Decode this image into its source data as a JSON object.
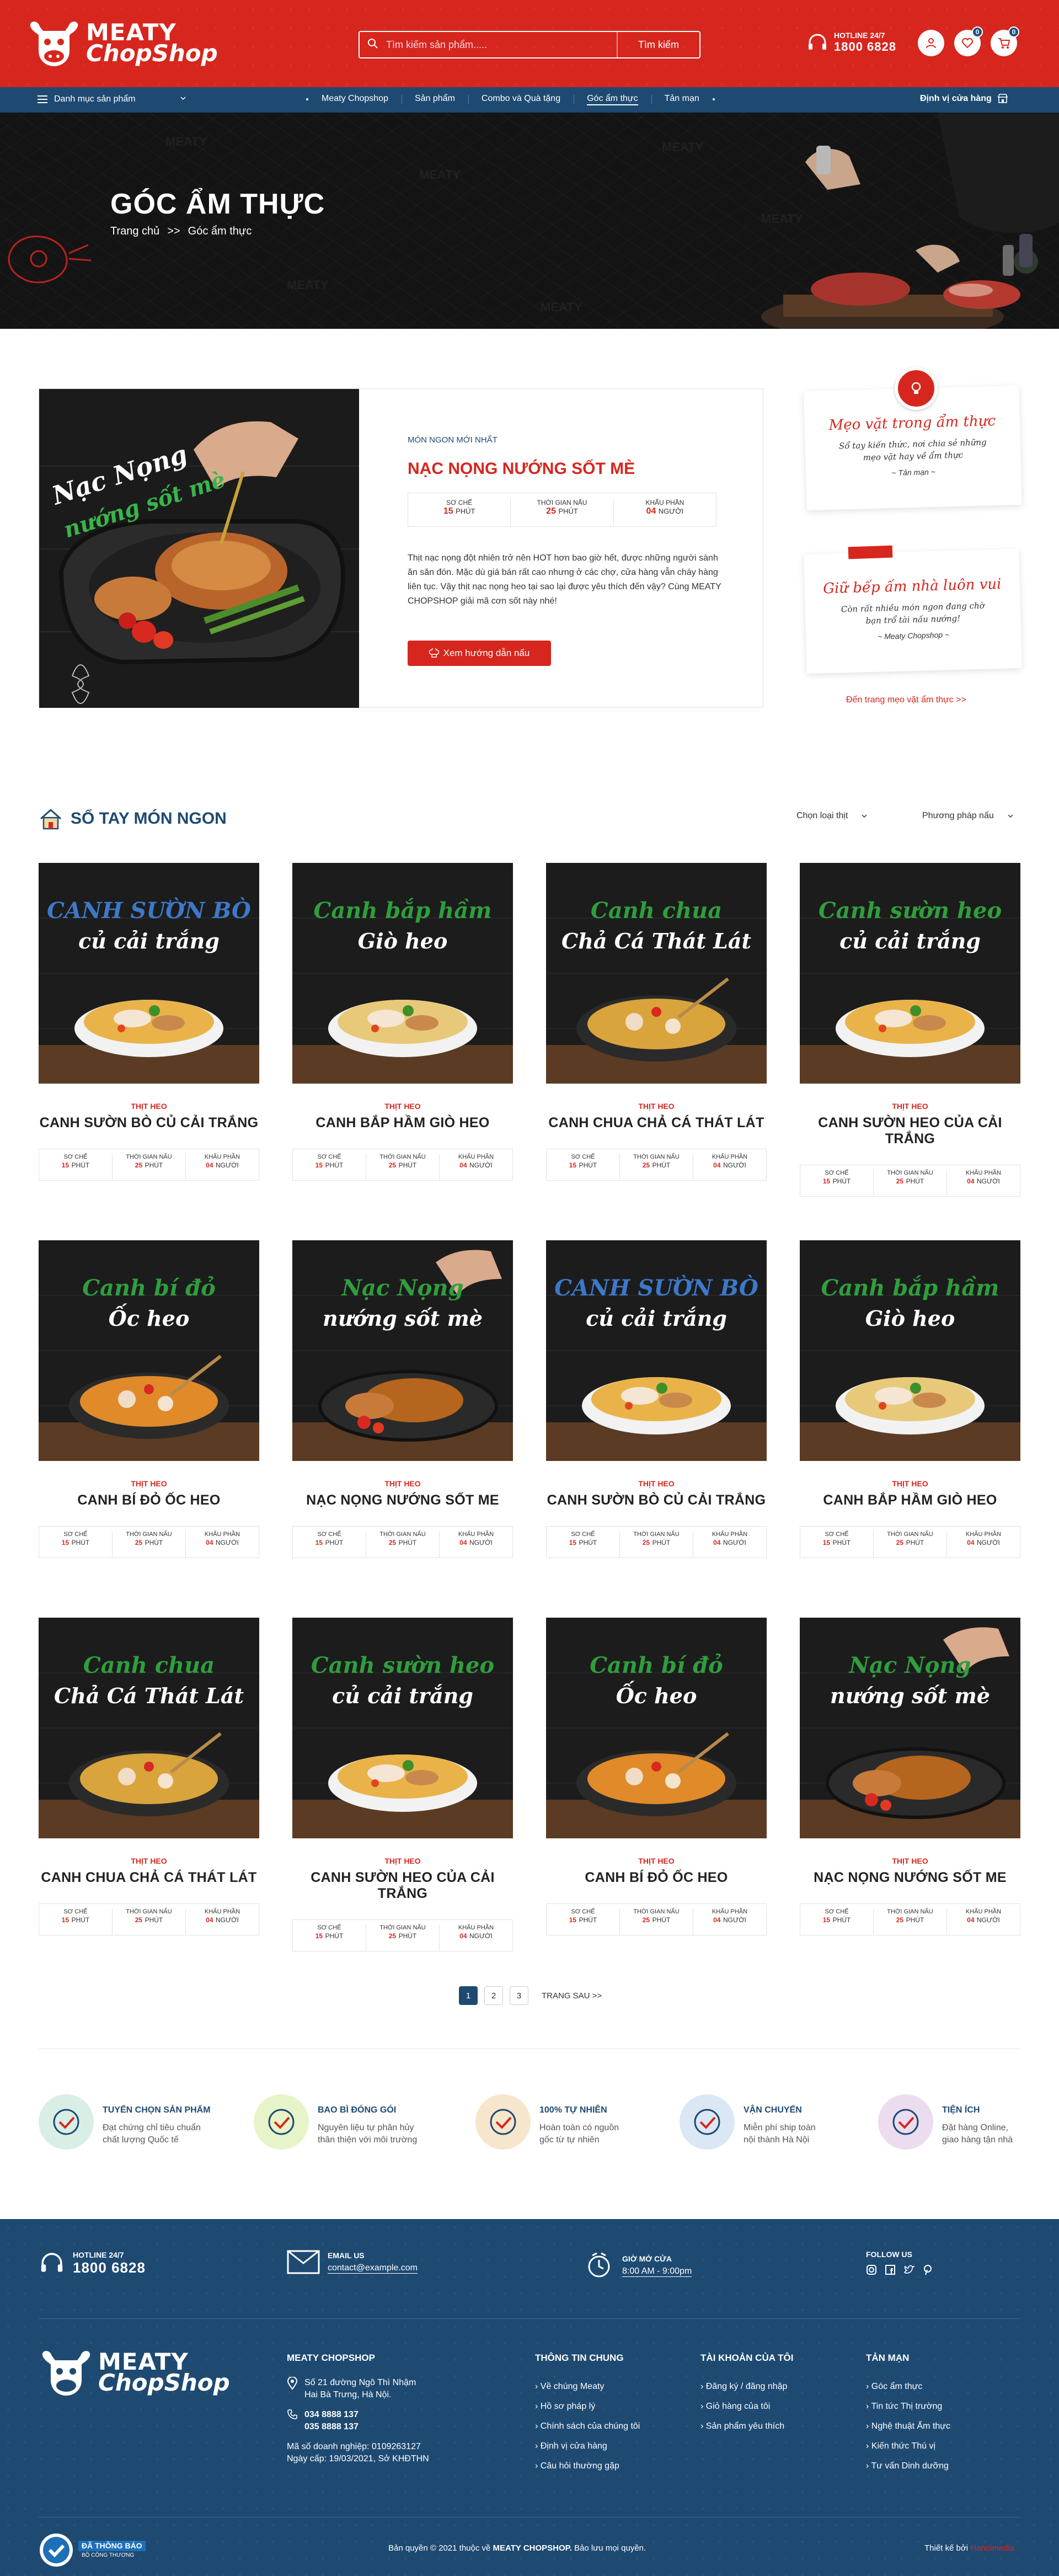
{
  "header": {
    "logo_line1": "MEATY",
    "logo_line2": "ChopShop",
    "search_placeholder": "Tìm kiếm sản phẩm.....",
    "search_button": "Tìm kiếm",
    "hotline_label": "HOTLINE 24/7",
    "hotline_number": "1800 6828",
    "wishlist_count": "0",
    "cart_count": "0"
  },
  "nav": {
    "category_label": "Danh mục sản phẩm",
    "items": [
      "Meaty Chopshop",
      "Sản phẩm",
      "Combo và Quà tặng",
      "Góc ẩm thực",
      "Tản mạn"
    ],
    "store_label": "Định vị cửa hàng"
  },
  "hero": {
    "title": "GÓC ẨM THỰC",
    "breadcrumb_home": "Trang chủ",
    "breadcrumb_sep": ">>",
    "breadcrumb_current": "Góc ẩm thực"
  },
  "featured": {
    "tag": "MÓN NGON MỚI NHẤT",
    "title": "NẠC NỌNG NƯỚNG SỐT MÈ",
    "image_text_1": "Nạc Nọng",
    "image_text_2": "nướng sốt mè",
    "stats": [
      {
        "label": "SƠ CHẾ",
        "value": "15",
        "unit": "PHÚT"
      },
      {
        "label": "THỜI GIAN NẤU",
        "value": "25",
        "unit": "PHÚT"
      },
      {
        "label": "KHẨU PHẦN",
        "value": "04",
        "unit": "NGƯỜI"
      }
    ],
    "description": "Thịt nạc nọng đột nhiên trở nên HOT hơn bao giờ hết, được những người sành ăn săn đón. Mặc dù giá bán rất cao nhưng ở các chợ, cửa hàng vẫn cháy hàng liên tục. Vậy thịt nạc nọng heo tại sao lại được yêu thích đến vậy? Cùng MEATY CHOPSHOP giải mã cơn sốt này nhé!",
    "button": "Xem hướng dẫn nấu"
  },
  "tips": [
    {
      "title": "Mẹo vặt trong ẩm thực",
      "desc1": "Sổ tay kiến thức, nơi chia sẻ những",
      "desc2": "mẹo vặt hay về ẩm thực",
      "author": "~ Tản mạn ~"
    },
    {
      "title": "Giữ bếp ấm nhà luôn vui",
      "desc1": "Còn rất nhiều món ngon đang chờ",
      "desc2": "bạn trổ tài nấu nướng!",
      "author": "~ Meaty Chopshop ~"
    }
  ],
  "tips_link": "Đến trang mẹo vặt ẩm thực >>",
  "section": {
    "title": "SỔ TAY MÓN NGON",
    "filter1": "Chọn loại thịt",
    "filter2": "Phương pháp nấu"
  },
  "card_stat_labels": {
    "prep": "SƠ CHẾ",
    "cook": "THỜI GIAN NẤU",
    "serve": "KHẨU PHẦN"
  },
  "recipes": [
    {
      "tag": "THỊT HEO",
      "name": "CANH SƯỜN BÒ CỦ CẢI TRẮNG",
      "l1": "CANH SƯỜN BÒ",
      "l2": "củ cải trắng",
      "prep": "15",
      "cook": "25",
      "serve": "04",
      "unit_time": "PHÚT",
      "unit_serve": "NGƯỜI",
      "color": "#3d78c9",
      "kind": "bowl",
      "soup": "#e9b34a"
    },
    {
      "tag": "THỊT HEO",
      "name": "CANH BẮP HẦM GIÒ HEO",
      "l1": "Canh bắp hầm",
      "l2": "Giò heo",
      "prep": "15",
      "cook": "25",
      "serve": "04",
      "unit_time": "PHÚT",
      "unit_serve": "NGƯỜI",
      "color": "#2f9e3d",
      "kind": "bowl",
      "soup": "#e8c97a"
    },
    {
      "tag": "THỊT HEO",
      "name": "CANH CHUA CHẢ CÁ THÁT LÁT",
      "l1": "Canh chua",
      "l2": "Chả Cá Thát Lát",
      "prep": "15",
      "cook": "25",
      "serve": "04",
      "unit_time": "PHÚT",
      "unit_serve": "NGƯỜI",
      "color": "#2f9e3d",
      "kind": "pot",
      "soup": "#d9a43c"
    },
    {
      "tag": "THỊT HEO",
      "name": "CANH SƯỜN HEO CỦA CẢI TRẮNG",
      "l1": "Canh sườn heo",
      "l2": "củ cải trắng",
      "prep": "15",
      "cook": "25",
      "serve": "04",
      "unit_time": "PHÚT",
      "unit_serve": "NGƯỜI",
      "color": "#2f9e3d",
      "kind": "bowl",
      "soup": "#e9b34a"
    },
    {
      "tag": "THỊT HEO",
      "name": "CANH BÍ ĐỎ ỐC HEO",
      "l1": "Canh bí đỏ",
      "l2": "Ốc heo",
      "prep": "15",
      "cook": "25",
      "serve": "04",
      "unit_time": "PHÚT",
      "unit_serve": "NGƯỜI",
      "color": "#2f9e3d",
      "kind": "pot",
      "soup": "#e08a2a"
    },
    {
      "tag": "THỊT HEO",
      "name": "NẠC NỌNG NƯỚNG SỐT ME",
      "l1": "Nạc Nọng",
      "l2": "nướng sốt mè",
      "prep": "15",
      "cook": "25",
      "serve": "04",
      "unit_time": "PHÚT",
      "unit_serve": "NGƯỜI",
      "color": "#2f9e3d",
      "kind": "pan",
      "soup": "#b5651d"
    },
    {
      "tag": "THỊT HEO",
      "name": "CANH SƯỜN BÒ CỦ CẢI TRẮNG",
      "l1": "CANH SƯỜN BÒ",
      "l2": "củ cải trắng",
      "prep": "15",
      "cook": "25",
      "serve": "04",
      "unit_time": "PHÚT",
      "unit_serve": "NGƯỜI",
      "color": "#3d78c9",
      "kind": "bowl",
      "soup": "#e9b34a"
    },
    {
      "tag": "THỊT HEO",
      "name": "CANH BẮP HẦM GIÒ HEO",
      "l1": "Canh bắp hầm",
      "l2": "Giò heo",
      "prep": "15",
      "cook": "25",
      "serve": "04",
      "unit_time": "PHÚT",
      "unit_serve": "NGƯỜI",
      "color": "#2f9e3d",
      "kind": "bowl",
      "soup": "#e8c97a"
    },
    {
      "tag": "THỊT HEO",
      "name": "CANH CHUA CHẢ CÁ THÁT LÁT",
      "l1": "Canh chua",
      "l2": "Chả Cá Thát Lát",
      "prep": "15",
      "cook": "25",
      "serve": "04",
      "unit_time": "PHÚT",
      "unit_serve": "NGƯỜI",
      "color": "#2f9e3d",
      "kind": "pot",
      "soup": "#d9a43c"
    },
    {
      "tag": "THỊT HEO",
      "name": "CANH SƯỜN HEO CỦA CẢI TRẮNG",
      "l1": "Canh sườn heo",
      "l2": "củ cải trắng",
      "prep": "15",
      "cook": "25",
      "serve": "04",
      "unit_time": "PHÚT",
      "unit_serve": "NGƯỜI",
      "color": "#2f9e3d",
      "kind": "bowl",
      "soup": "#e9b34a"
    },
    {
      "tag": "THỊT HEO",
      "name": "CANH BÍ ĐỎ ỐC HEO",
      "l1": "Canh bí đỏ",
      "l2": "Ốc heo",
      "prep": "15",
      "cook": "25",
      "serve": "04",
      "unit_time": "PHÚT",
      "unit_serve": "NGƯỜI",
      "color": "#2f9e3d",
      "kind": "pot",
      "soup": "#e08a2a"
    },
    {
      "tag": "THỊT HEO",
      "name": "NẠC NỌNG NƯỚNG SỐT ME",
      "l1": "Nạc Nọng",
      "l2": "nướng sốt mè",
      "prep": "15",
      "cook": "25",
      "serve": "04",
      "unit_time": "PHÚT",
      "unit_serve": "NGƯỜI",
      "color": "#2f9e3d",
      "kind": "pan",
      "soup": "#b5651d"
    }
  ],
  "pagination": {
    "pages": [
      "1",
      "2",
      "3"
    ],
    "next": "TRANG SAU >>",
    "current": "1"
  },
  "features": [
    {
      "title": "TUYỂN CHỌN SẢN PHẨM",
      "desc1": "Đạt chứng chỉ tiêu chuẩn",
      "desc2": "chất lượng Quốc tế",
      "bg": "#d9efe6",
      "icon": "meat-icon"
    },
    {
      "title": "BAO BÌ ĐÓNG GÓI",
      "desc1": "Nguyên liệu tự phân hủy",
      "desc2": "thân thiện với môi trường",
      "bg": "#e7f3c9",
      "icon": "package-icon"
    },
    {
      "title": "100% TỰ NHIÊN",
      "desc1": "Hoàn toàn có nguồn",
      "desc2": "gốc từ tự nhiên",
      "bg": "#f6e6cc",
      "icon": "leaf-icon"
    },
    {
      "title": "VẬN CHUYỂN",
      "desc1": "Miễn phí ship toàn",
      "desc2": "nội thành Hà Nội",
      "bg": "#dbe7f5",
      "icon": "truck-icon"
    },
    {
      "title": "TIỆN ÍCH",
      "desc1": "Đặt hàng Online,",
      "desc2": "giao hàng tận nhà",
      "bg": "#ecdcf0",
      "icon": "cart-icon"
    }
  ],
  "footer": {
    "hotline_label": "HOTLINE 24/7",
    "hotline": "1800 6828",
    "email_label": "EMAIL US",
    "email": "contact@example.com",
    "hours_label": "GIỜ MỞ CỬA",
    "hours": "8:00 AM - 9:00pm",
    "follow_label": "FOLLOW US",
    "company_title": "MEATY CHOPSHOP",
    "address1": "Số 21 đường Ngô Thì Nhậm",
    "address2": "Hai Bà Trưng, Hà Nội.",
    "phone1": "034 8888 137",
    "phone2": "035 8888 137",
    "tax": "Mã số doanh nghiệp: 0109263127",
    "issued": "Ngày cấp: 19/03/2021, Sở KHĐTHN",
    "columns": [
      {
        "title": "THÔNG TIN CHUNG",
        "items": [
          "Về chúng Meaty",
          "Hồ sơ pháp lý",
          "Chính sách của chúng tôi",
          "Định vị cửa hàng",
          "Câu hỏi thường gặp"
        ]
      },
      {
        "title": "TÀI KHOẢN CỦA TÔI",
        "items": [
          "Đăng ký / đăng nhập",
          "Giỏ hàng của tôi",
          "Sản phẩm yêu thích"
        ]
      },
      {
        "title": "TẢN MẠN",
        "items": [
          "Góc ẩm thực",
          "Tin tức Thị trường",
          "Nghệ thuật Ẩm thực",
          "Kiến thức Thú vị",
          "Tư vấn Dinh dưỡng"
        ]
      }
    ],
    "badge1": "ĐÃ THÔNG BÁO",
    "badge2": "BỘ CÔNG THƯƠNG",
    "copyright_pre": "Bản quyền © 2021 thuộc về",
    "copyright_brand": "MEATY CHOPSHOP.",
    "copyright_post": "Bảo lưu mọi quyền.",
    "design_by": "Thiết kế bởi",
    "designer": "Hanoimedia"
  },
  "colors": {
    "primary_red": "#d7261d",
    "navy": "#1e4a72"
  }
}
